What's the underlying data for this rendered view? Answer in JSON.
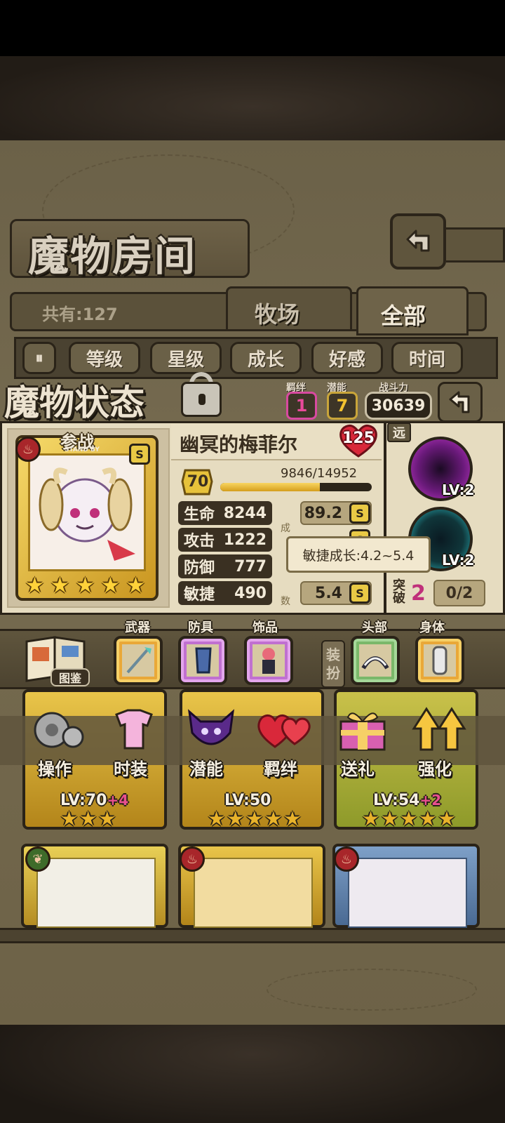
{
  "header": {
    "title": "魔物房间",
    "count_label": "共有:127",
    "tabs": [
      {
        "label": "牧场"
      },
      {
        "label": "全部"
      }
    ]
  },
  "sort_buttons": [
    "等级",
    "星级",
    "成长",
    "好感",
    "时间"
  ],
  "status": {
    "title": "魔物状态",
    "bond_label": "羁绊",
    "bond_value": "1",
    "potential_label": "潜能",
    "potential_value": "7",
    "power_label": "战斗力",
    "power_value": "30639"
  },
  "monster": {
    "standby_label": "参战",
    "standby_sub": "STAND BY",
    "rank": "S",
    "element": "fire",
    "name": "幽冥的梅菲尔",
    "affection": "125",
    "level": "70",
    "exp": "9846/14952",
    "exp_fraction": 0.658,
    "stars": 5,
    "stats": [
      {
        "label": "生命",
        "value": "8244",
        "growth": "89.2",
        "rank": "S"
      },
      {
        "label": "攻击",
        "value": "1222",
        "growth": "",
        "rank": "S"
      },
      {
        "label": "防御",
        "value": "777",
        "growth": "",
        "rank": ""
      },
      {
        "label": "敏捷",
        "value": "490",
        "growth": "5.4",
        "rank": "S"
      }
    ],
    "growth_vertical": [
      "成",
      "数"
    ],
    "tooltip": "敏捷成长:4.2~5.4"
  },
  "skills": {
    "range_label": "远",
    "skill1_level": "LV:2",
    "skill2_level": "LV:2",
    "break_label": "突破",
    "break_value": "2",
    "break_progress": "0/2"
  },
  "equipment": {
    "book_label": "图鉴",
    "weapon_label": "武器",
    "armor_label": "防具",
    "accessory_label": "饰品",
    "dress_label": [
      "装",
      "扮"
    ],
    "head_label": "头部",
    "body_label": "身体"
  },
  "actions": [
    {
      "label": "操作",
      "icon": "gear-icon"
    },
    {
      "label": "时装",
      "icon": "costume-icon"
    },
    {
      "label": "潜能",
      "icon": "demon-icon"
    },
    {
      "label": "羁绊",
      "icon": "hearts-icon"
    },
    {
      "label": "送礼",
      "icon": "gift-icon"
    },
    {
      "label": "强化",
      "icon": "upgrade-arrows-icon"
    }
  ],
  "grid_levels": [
    {
      "lv": "LV:70",
      "plus": "+4"
    },
    {
      "lv": "LV:50",
      "plus": ""
    },
    {
      "lv": "LV:54",
      "plus": "+2"
    }
  ],
  "colors": {
    "gold": "#f2c230",
    "fire": "#a8262a",
    "pink": "#d84aa0",
    "panel": "#e6dcc0"
  }
}
